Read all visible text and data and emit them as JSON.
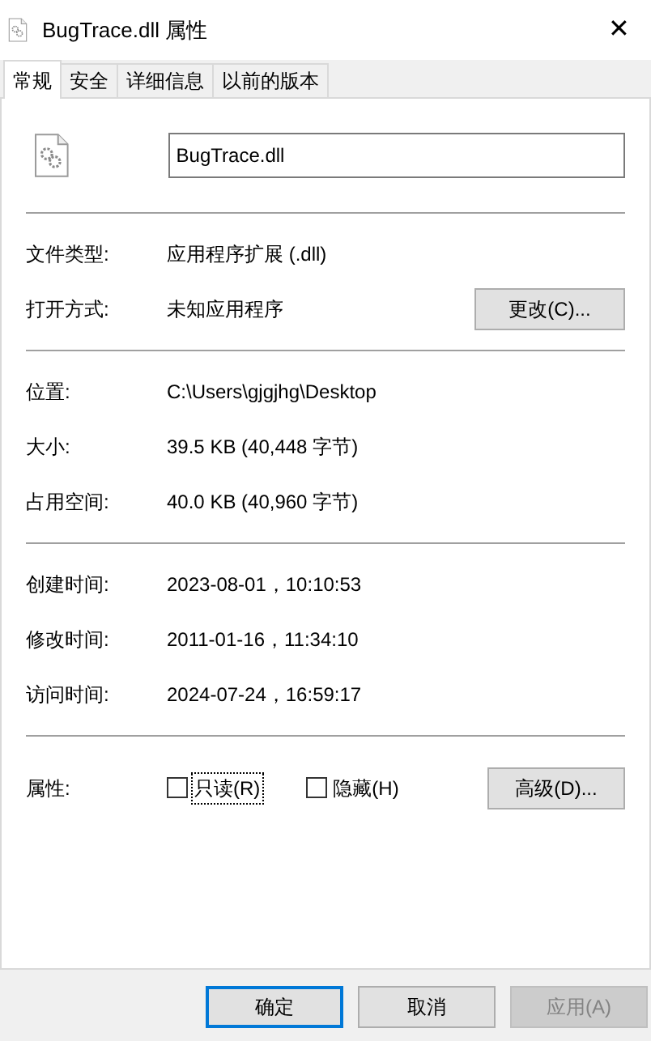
{
  "window": {
    "title": "BugTrace.dll 属性",
    "close": "✕"
  },
  "tabs": [
    {
      "label": "常规",
      "selected": true
    },
    {
      "label": "安全",
      "selected": false
    },
    {
      "label": "详细信息",
      "selected": false
    },
    {
      "label": "以前的版本",
      "selected": false
    }
  ],
  "file_name": {
    "value": "BugTrace.dll"
  },
  "sections": [
    [
      {
        "label": "文件类型:",
        "value": "应用程序扩展 (.dll)"
      },
      {
        "label": "打开方式:",
        "value": "未知应用程序",
        "button": "更改(C)..."
      }
    ],
    [
      {
        "label": "位置:",
        "value": "C:\\Users\\gjgjhg\\Desktop"
      },
      {
        "label": "大小:",
        "value": "39.5 KB (40,448 字节)"
      },
      {
        "label": "占用空间:",
        "value": "40.0 KB (40,960 字节)"
      }
    ],
    [
      {
        "label": "创建时间:",
        "value": "2023-08-01，10:10:53"
      },
      {
        "label": "修改时间:",
        "value": "2011-01-16，11:34:10"
      },
      {
        "label": "访问时间:",
        "value": "2024-07-24，16:59:17"
      }
    ]
  ],
  "attributes": {
    "label": "属性:",
    "checkboxes": [
      {
        "label": "只读(R)",
        "checked": false,
        "focused": true
      },
      {
        "label": "隐藏(H)",
        "checked": false,
        "focused": false
      }
    ],
    "button": "高级(D)..."
  },
  "buttons": [
    {
      "label": "确定",
      "default": true,
      "disabled": false
    },
    {
      "label": "取消",
      "default": false,
      "disabled": false
    },
    {
      "label": "应用(A)",
      "default": false,
      "disabled": true
    }
  ]
}
